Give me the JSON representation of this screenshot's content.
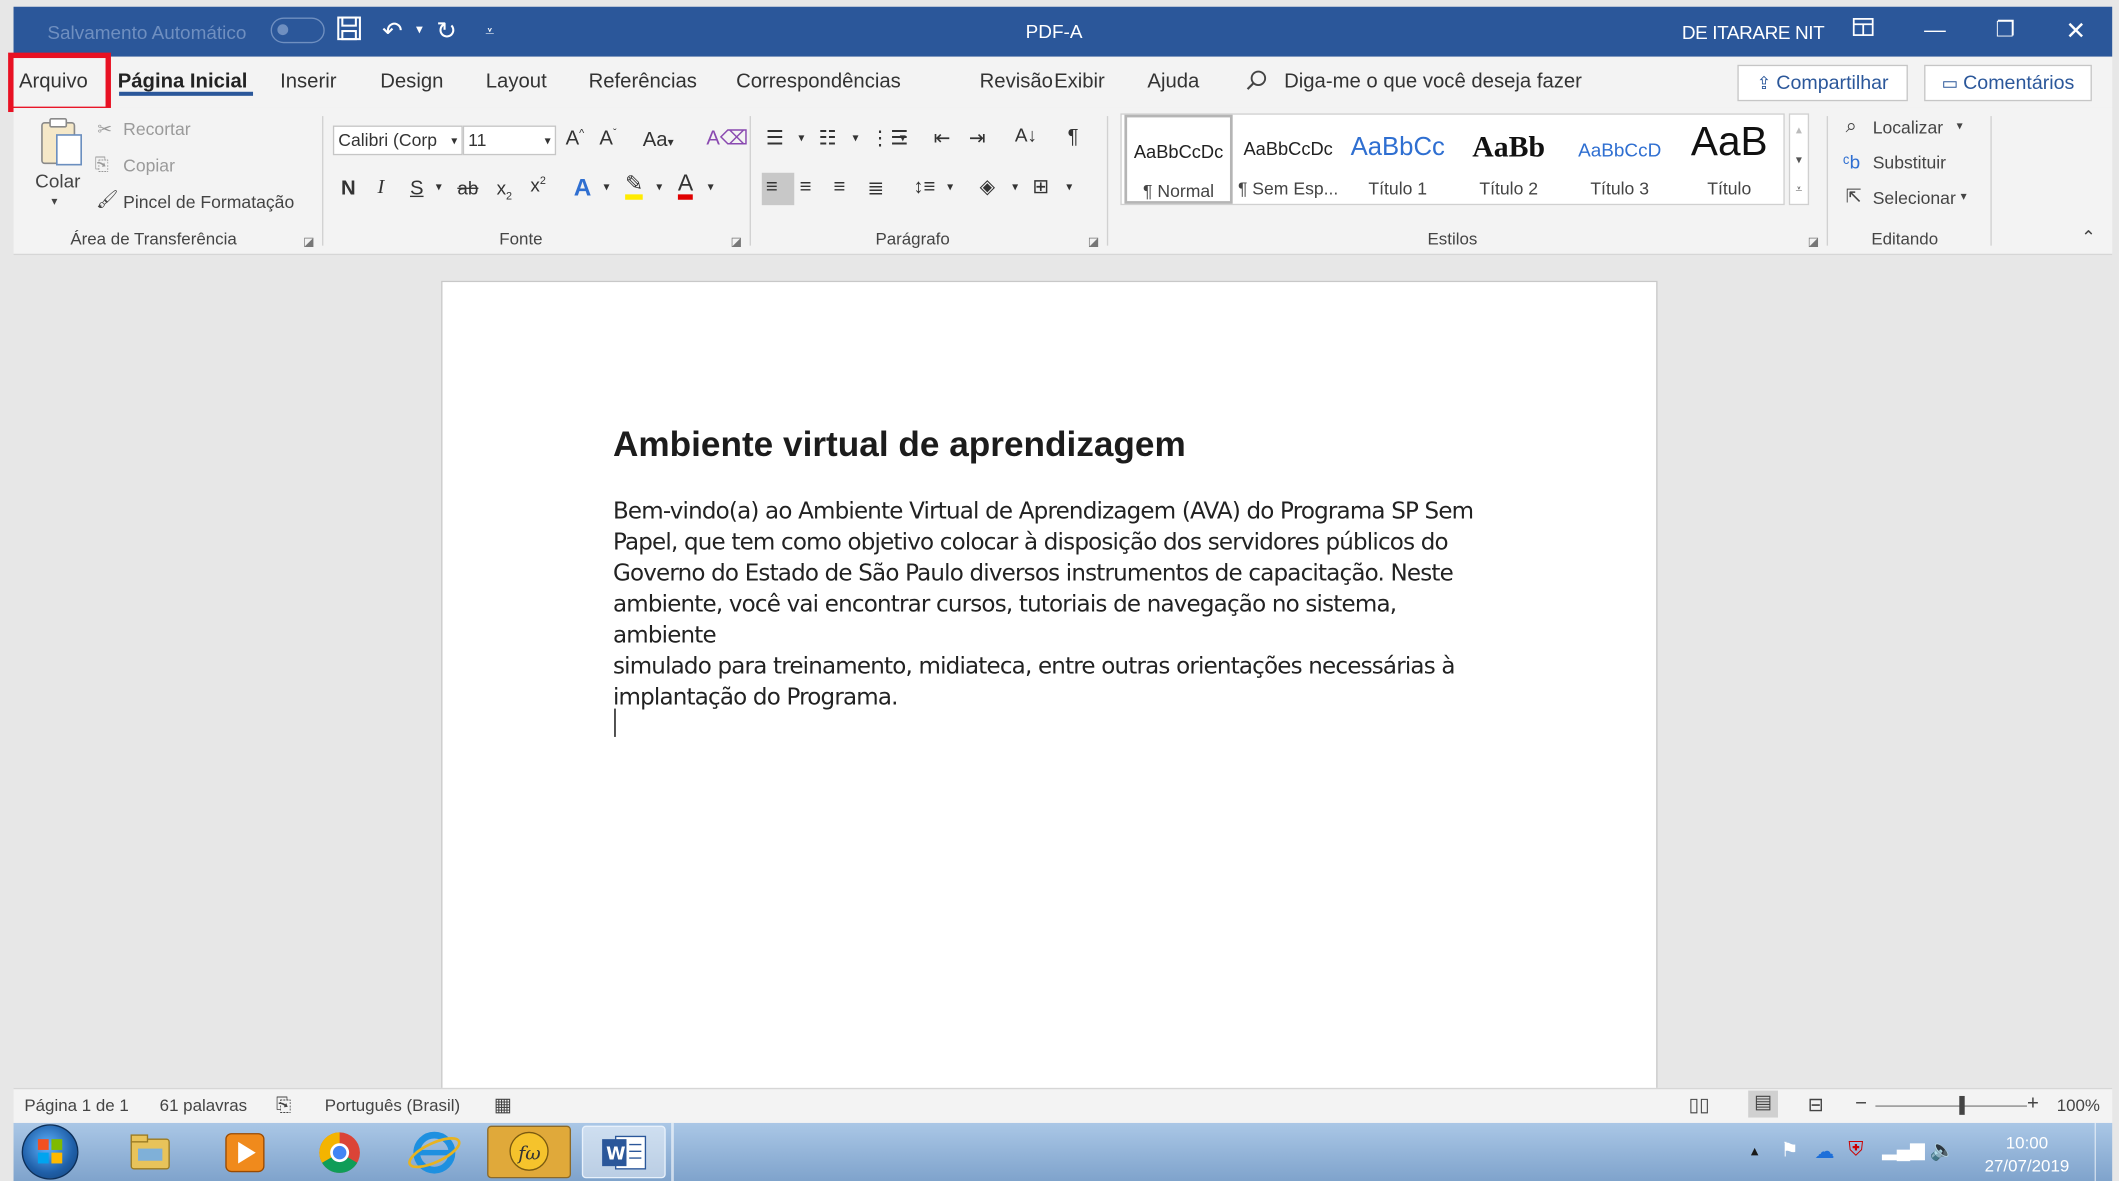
{
  "titlebar": {
    "autosave_label": "Salvamento Automático",
    "doc_title": "PDF-A",
    "user": "DE ITARARE NIT"
  },
  "tabs": {
    "arquivo": "Arquivo",
    "pagina_inicial": "Página Inicial",
    "inserir": "Inserir",
    "design": "Design",
    "layout": "Layout",
    "referencias": "Referências",
    "correspondencias": "Correspondências",
    "revisao": "Revisão",
    "exibir": "Exibir",
    "ajuda": "Ajuda",
    "tell_me": "Diga-me o que você deseja fazer",
    "share": "Compartilhar",
    "comments": "Comentários"
  },
  "ribbon": {
    "clipboard": {
      "paste": "Colar",
      "cut": "Recortar",
      "copy": "Copiar",
      "format_painter": "Pincel de Formatação",
      "label": "Área de Transferência"
    },
    "font": {
      "name": "Calibri (Corp",
      "size": "11",
      "bold": "N",
      "italic": "I",
      "underline": "S",
      "strike": "ab",
      "case": "Aa",
      "label": "Fonte"
    },
    "paragraph": {
      "label": "Parágrafo"
    },
    "styles": {
      "label": "Estilos",
      "items": [
        {
          "preview": "AaBbCcDc",
          "name": "¶ Normal"
        },
        {
          "preview": "AaBbCcDc",
          "name": "¶ Sem Esp..."
        },
        {
          "preview": "AaBbCc",
          "name": "Título 1"
        },
        {
          "preview": "AaBb",
          "name": "Título 2"
        },
        {
          "preview": "AaBbCcD",
          "name": "Título 3"
        },
        {
          "preview": "AaB",
          "name": "Título"
        }
      ]
    },
    "editing": {
      "label": "Editando",
      "find": "Localizar",
      "replace": "Substituir",
      "select": "Selecionar"
    }
  },
  "document": {
    "heading": "Ambiente virtual de aprendizagem",
    "lines": [
      "Bem-vindo(a) ao Ambiente Virtual de Aprendizagem (AVA) do Programa SP Sem",
      "Papel, que tem como objetivo colocar à disposição dos servidores públicos do",
      "Governo do Estado de São Paulo diversos instrumentos de capacitação. Neste",
      "ambiente, você vai encontrar cursos, tutoriais de navegação no sistema, ambiente",
      "simulado para treinamento, midiateca, entre outras orientações necessárias à",
      "implantação do Programa."
    ]
  },
  "status": {
    "page": "Página 1 de 1",
    "words": "61 palavras",
    "language": "Português (Brasil)",
    "zoom": "100%",
    "zoom_level": 1.0
  },
  "taskbar": {
    "time": "10:00",
    "date": "27/07/2019"
  },
  "colors": {
    "titlebar": "#2b579a",
    "highlight": "#e81123"
  }
}
